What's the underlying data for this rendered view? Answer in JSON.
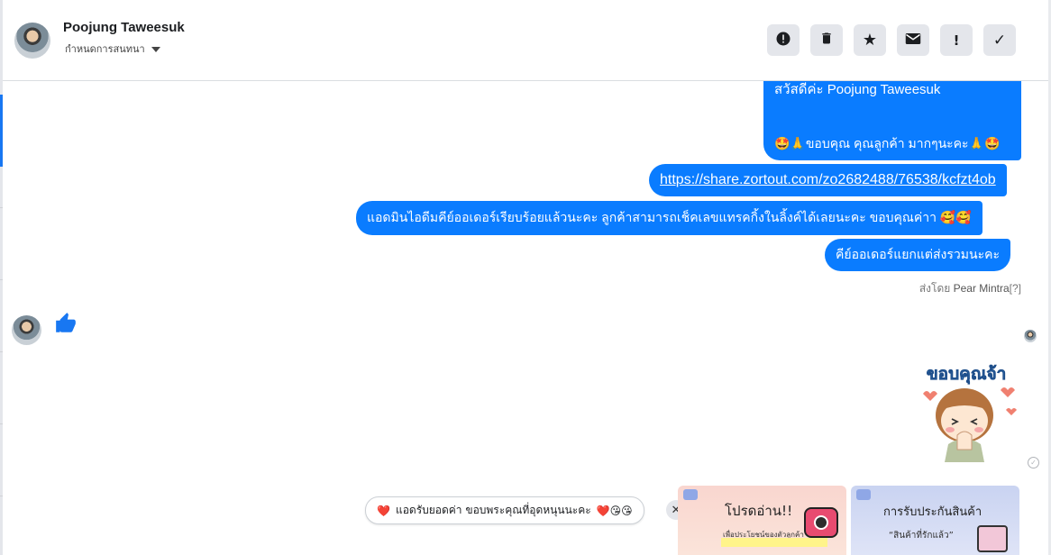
{
  "header": {
    "name": "Poojung Taweesuk",
    "subtitle": "กำหนดการสนทนา",
    "actions": [
      {
        "icon": "alert-circle-icon",
        "glyph": "!"
      },
      {
        "icon": "trash-icon",
        "glyph": ""
      },
      {
        "icon": "star-icon",
        "glyph": "★"
      },
      {
        "icon": "envelope-icon",
        "glyph": ""
      },
      {
        "icon": "exclamation-icon",
        "glyph": "!"
      },
      {
        "icon": "check-icon",
        "glyph": "✓"
      }
    ]
  },
  "messages": {
    "greeting_line": "สวัสดีค่ะ Poojung Taweesuk",
    "thanks_line": "🤩🙏ขอบคุณ คุณลูกค้า มากๆนะคะ🙏🤩",
    "link": "https://share.zortout.com/zo2682488/76538/kcfzt4ob",
    "order_msg": "แอดมินไอดีมคีย์ออเดอร์เรียบร้อยแล้วนะคะ ลูกค้าสามารถเช็คเลขแทรคกิ้งในลิ้งค์ได้เลยนะคะ ขอบคุณค่าา 🥰🥰",
    "note_msg": "คีย์ออเดอร์แยกแต่ส่งรวมนะคะ",
    "sent_by_prefix": "ส่งโดย",
    "sent_by_name": "Pear Mintra",
    "sent_by_help": "[?]"
  },
  "sticker": {
    "text": "ขอบคุณจ้า"
  },
  "quick_reply": {
    "chip_text": "แอดรับยอดค่า ขอบพระคุณที่อุดหนุนนะคะ",
    "chip_emoji": "❤️😘😘",
    "chip_heart": "❤️"
  },
  "cards": [
    {
      "title": "โปรดอ่าน!!",
      "subtitle": "เพื่อประโยชน์ของตัวลูกค้า"
    },
    {
      "title": "การรับประกันสินค้า",
      "subtitle": "“สินค้าที่รักแล้ว”"
    }
  ],
  "colors": {
    "bubble": "#0a7cff",
    "accent": "#1877f2",
    "button_bg": "#e4e6eb"
  }
}
